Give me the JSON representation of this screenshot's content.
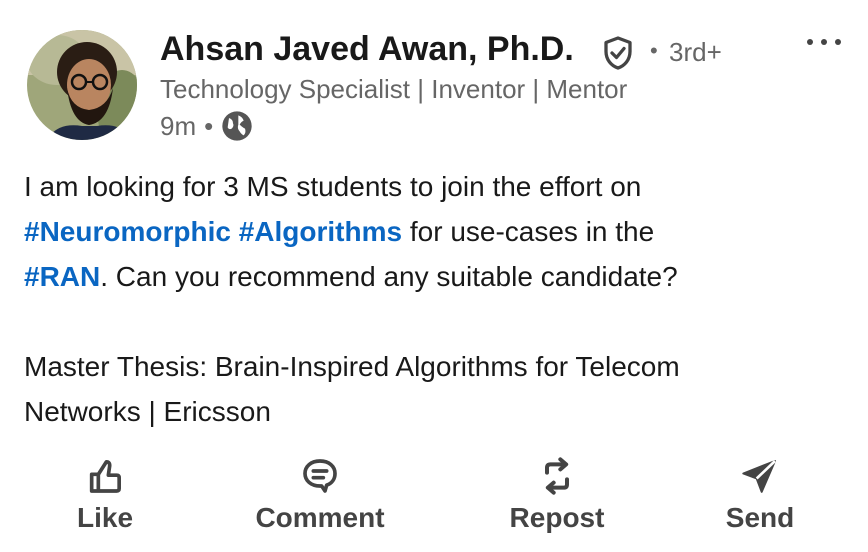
{
  "author": {
    "name": "Ahsan Javed Awan, Ph.D.",
    "verified_icon": "shield-check-icon",
    "degree": "3rd+",
    "headline": "Technology Specialist | Inventor | Mentor",
    "time": "9m",
    "visibility_icon": "globe-icon"
  },
  "post": {
    "line1": "I am looking for 3 MS students to join the effort on",
    "tag_neuromorphic": "#Neuromorphic",
    "tag_algorithms": "#Algorithms",
    "line2_rest": "for use-cases in the",
    "tag_ran": "#RAN",
    "line3_rest": ". Can you recommend any suitable candidate?",
    "thesis_line1": "Master Thesis: Brain-Inspired Algorithms for Telecom",
    "thesis_line2": "Networks | Ericsson"
  },
  "actions": {
    "like": {
      "label": "Like",
      "icon": "thumbs-up-icon"
    },
    "comment": {
      "label": "Comment",
      "icon": "comment-icon"
    },
    "repost": {
      "label": "Repost",
      "icon": "repost-icon"
    },
    "send": {
      "label": "Send",
      "icon": "send-icon"
    }
  },
  "colors": {
    "hashtag": "#0a66c2",
    "text": "#191919",
    "secondary": "#666666",
    "action": "#444444"
  }
}
